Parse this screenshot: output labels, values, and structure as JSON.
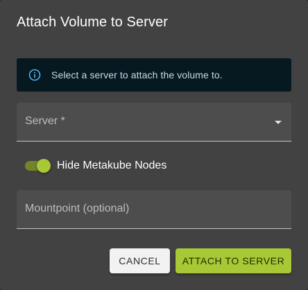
{
  "dialog": {
    "title": "Attach Volume to Server",
    "info": {
      "icon": "info-icon",
      "text": "Select a server to attach the volume to."
    },
    "server_field": {
      "label": "Server *",
      "icon": "dropdown-arrow-icon"
    },
    "toggle": {
      "label": "Hide Metakube Nodes",
      "checked": true
    },
    "mountpoint_field": {
      "placeholder": "Mountpoint (optional)"
    },
    "buttons": {
      "cancel": "CANCEL",
      "attach": "ATTACH TO SERVER"
    }
  },
  "colors": {
    "dialog_bg": "#424242",
    "info_bg": "#061820",
    "info_icon": "#4fb0e6",
    "accent": "#a8c935",
    "field_bg": "#4d4d4d"
  }
}
